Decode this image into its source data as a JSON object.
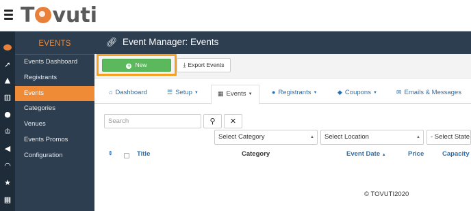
{
  "app": {
    "logo_text_pre": "T",
    "logo_text_post": "vuti"
  },
  "rail": {
    "icons": [
      "brand-icon",
      "rocket-icon",
      "graduation-cap-icon",
      "bar-chart-icon",
      "users-icon",
      "trophy-icon",
      "bullhorn-icon",
      "rss-icon",
      "star-icon",
      "table-icon"
    ]
  },
  "sidebar": {
    "title": "EVENTS",
    "items": [
      {
        "label": "Events Dashboard",
        "active": false
      },
      {
        "label": "Registrants",
        "active": false
      },
      {
        "label": "Events",
        "active": true
      },
      {
        "label": "Categories",
        "active": false
      },
      {
        "label": "Venues",
        "active": false
      },
      {
        "label": "Events Promos",
        "active": false
      },
      {
        "label": "Configuration",
        "active": false
      }
    ]
  },
  "page": {
    "title": "Event Manager: Events"
  },
  "toolbar": {
    "new_label": "New",
    "export_label": "Export Events"
  },
  "tabs": [
    {
      "label": "Dashboard",
      "icon": "home-icon"
    },
    {
      "label": "Setup",
      "icon": "list-icon"
    },
    {
      "label": "Events",
      "icon": "calendar-icon"
    },
    {
      "label": "Registrants",
      "icon": "user-icon"
    },
    {
      "label": "Coupons",
      "icon": "tag-icon"
    },
    {
      "label": "Emails & Messages",
      "icon": "envelope-icon"
    }
  ],
  "filters": {
    "search_placeholder": "Search",
    "category": "Select Category",
    "location": "Select Location",
    "state": "- Select State -"
  },
  "table": {
    "headers": {
      "title": "Title",
      "category": "Category",
      "event_date": "Event Date",
      "price": "Price",
      "capacity": "Capacity"
    }
  },
  "footer": {
    "copyright": "© TOVUTI2020"
  },
  "colors": {
    "accent": "#ef8a36",
    "sidebar": "#2c3e50",
    "new_button": "#5cb85c",
    "highlight": "#f5a01e",
    "link": "#2a6fb0"
  }
}
